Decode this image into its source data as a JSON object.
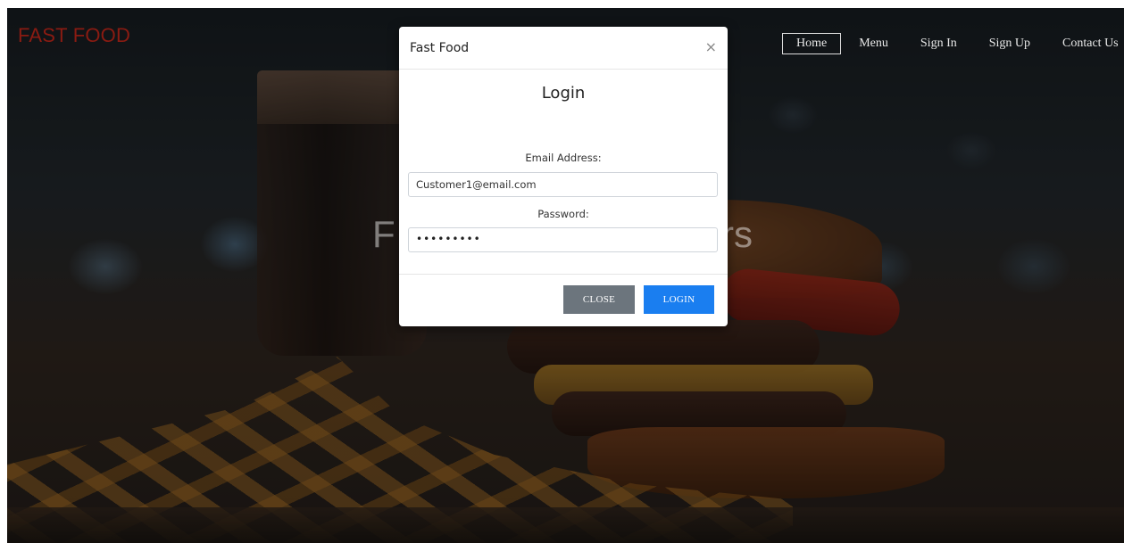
{
  "brand": "FAST FOOD",
  "nav": {
    "items": [
      "Home",
      "Menu",
      "Sign In",
      "Sign Up",
      "Contact Us"
    ],
    "active": "Home"
  },
  "hero": {
    "text_left": "F",
    "text_right": "rs"
  },
  "modal": {
    "title": "Fast Food",
    "close_icon": "×",
    "heading": "Login",
    "email_label": "Email Address:",
    "email_value": "Customer1@email.com",
    "password_label": "Password:",
    "password_mask": "•••••••••",
    "close_button": "CLOSE",
    "login_button": "LOGIN"
  },
  "colors": {
    "brand": "#8a1b12",
    "primary_button": "#1a7ef0",
    "secondary_button": "#6c757d"
  }
}
